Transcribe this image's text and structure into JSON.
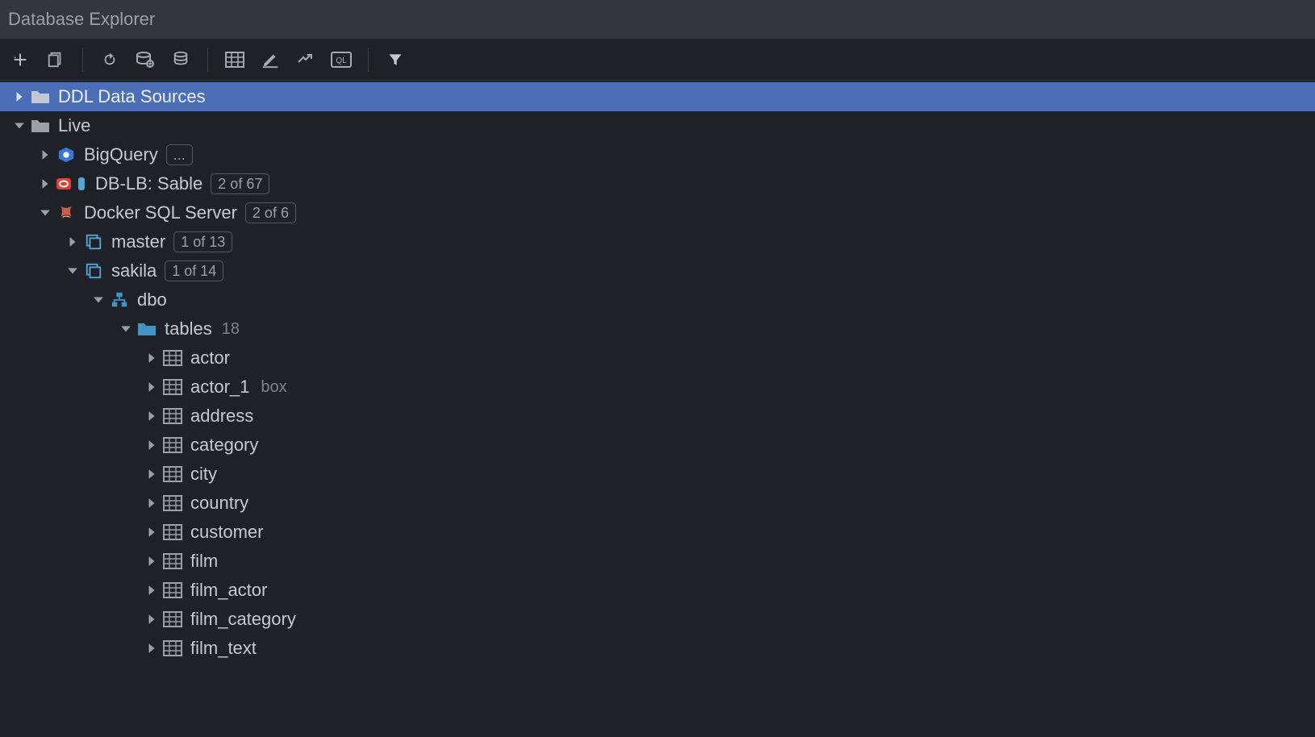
{
  "window": {
    "title": "Database Explorer"
  },
  "toolbar": {
    "buttons": [
      "add",
      "copy",
      "refresh",
      "datasource-props",
      "stack",
      "grid",
      "edit",
      "migrate",
      "ql",
      "filter"
    ]
  },
  "tree": {
    "ddl": {
      "label": "DDL Data Sources"
    },
    "live": {
      "label": "Live"
    },
    "bigquery": {
      "label": "BigQuery",
      "badge": "..."
    },
    "dblb": {
      "label": "DB-LB: Sable",
      "badge": "2 of 67"
    },
    "docker": {
      "label": "Docker SQL Server",
      "badge": "2 of 6"
    },
    "master": {
      "label": "master",
      "badge": "1 of 13"
    },
    "sakila": {
      "label": "sakila",
      "badge": "1 of 14"
    },
    "dbo": {
      "label": "dbo"
    },
    "tablesFolder": {
      "label": "tables",
      "count": "18"
    },
    "tables": [
      {
        "name": "actor",
        "suffix": ""
      },
      {
        "name": "actor_1",
        "suffix": "box"
      },
      {
        "name": "address",
        "suffix": ""
      },
      {
        "name": "category",
        "suffix": ""
      },
      {
        "name": "city",
        "suffix": ""
      },
      {
        "name": "country",
        "suffix": ""
      },
      {
        "name": "customer",
        "suffix": ""
      },
      {
        "name": "film",
        "suffix": ""
      },
      {
        "name": "film_actor",
        "suffix": ""
      },
      {
        "name": "film_category",
        "suffix": ""
      },
      {
        "name": "film_text",
        "suffix": ""
      }
    ]
  },
  "colors": {
    "folder": "#9aa0a6",
    "folderBlue": "#3e95c6",
    "dbStack": "#57a7d6",
    "schema": "#3e95c6",
    "table": "#9aa0a6",
    "oracle": "#e63e2f",
    "indicator": "#4fa7d8"
  }
}
